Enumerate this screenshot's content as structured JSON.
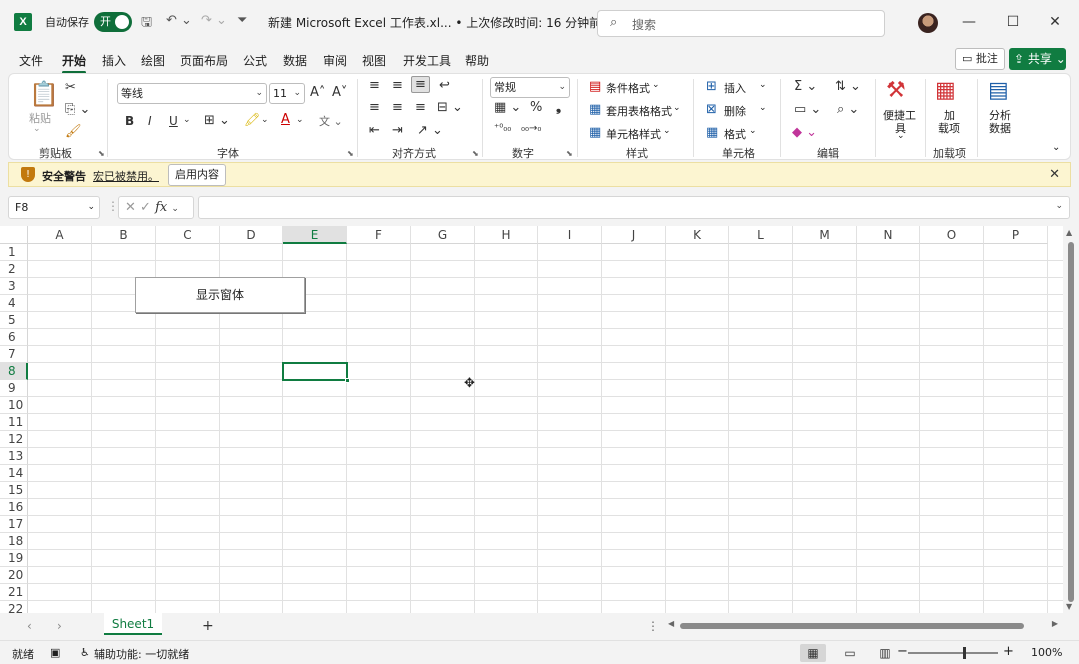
{
  "titlebar": {
    "app_icon": "X",
    "autosave_label": "自动保存",
    "autosave_state": "开",
    "doc_title": "新建 Microsoft Excel 工作表.xl... • 上次修改时间: 16 分钟前 ∨",
    "search_placeholder": "搜索",
    "minimize": "—",
    "maximize": "☐",
    "close": "✕"
  },
  "tabs": [
    "文件",
    "开始",
    "插入",
    "绘图",
    "页面布局",
    "公式",
    "数据",
    "审阅",
    "视图",
    "开发工具",
    "帮助"
  ],
  "active_tab": "开始",
  "comment_btn": "批注",
  "share_btn": "共享",
  "ribbon": {
    "clipboard": {
      "paste": "粘贴",
      "label": "剪贴板"
    },
    "font": {
      "name": "等线",
      "size": "11",
      "label": "字体"
    },
    "alignment": {
      "label": "对齐方式"
    },
    "number": {
      "format": "常规",
      "label": "数字"
    },
    "styles": {
      "conditional": "条件格式",
      "table": "套用表格格式",
      "cell": "单元格样式",
      "label": "样式"
    },
    "cells": {
      "insert": "插入",
      "delete": "删除",
      "format": "格式",
      "label": "单元格"
    },
    "editing": {
      "label": "编辑"
    },
    "quicktools": {
      "label1": "便捷工",
      "label2": "具"
    },
    "addins": {
      "label1": "加",
      "label2": "载项",
      "group": "加载项"
    },
    "analysis": {
      "label1": "分析",
      "label2": "数据"
    }
  },
  "security_bar": {
    "title": "安全警告",
    "message": "宏已被禁用。",
    "button": "启用内容"
  },
  "formula_bar": {
    "name_box": "F8",
    "fx": "fx",
    "formula": ""
  },
  "grid": {
    "columns": [
      "A",
      "B",
      "C",
      "D",
      "E",
      "F",
      "G",
      "H",
      "I",
      "J",
      "K",
      "L",
      "M",
      "N",
      "O",
      "P"
    ],
    "rows": [
      "1",
      "2",
      "3",
      "4",
      "5",
      "6",
      "7",
      "8",
      "9",
      "10",
      "11",
      "12",
      "13",
      "14",
      "15",
      "16",
      "17",
      "18",
      "19",
      "20",
      "21",
      "22"
    ],
    "selected_column": "E",
    "selected_row": "8",
    "form_button": "显示窗体"
  },
  "sheets": [
    "Sheet1"
  ],
  "status": {
    "ready": "就绪",
    "accessibility": "辅助功能: 一切就绪",
    "zoom": "100%"
  }
}
